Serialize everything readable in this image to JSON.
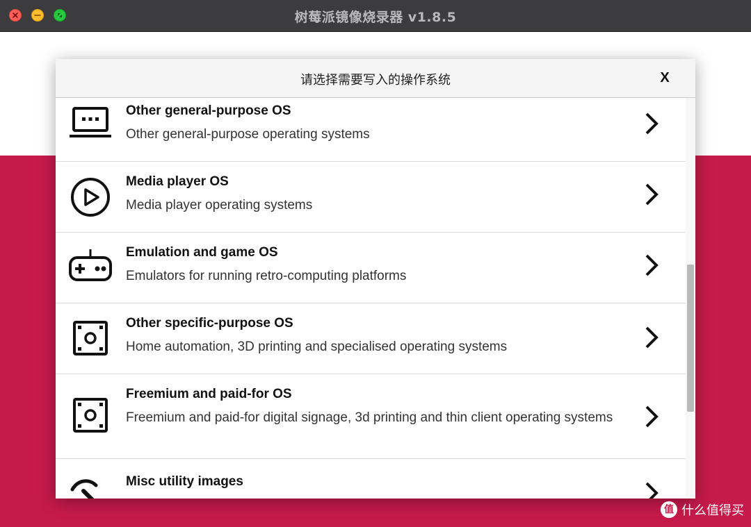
{
  "window": {
    "title": "树莓派镜像烧录器 v1.8.5"
  },
  "dialog": {
    "title": "请选择需要写入的操作系统",
    "close_label": "X"
  },
  "items": [
    {
      "title": "Other general-purpose OS",
      "desc": "Other general-purpose operating systems",
      "icon": "laptop-icon"
    },
    {
      "title": "Media player OS",
      "desc": "Media player operating systems",
      "icon": "play-circle-icon"
    },
    {
      "title": "Emulation and game OS",
      "desc": "Emulators for running retro-computing platforms",
      "icon": "gamepad-icon"
    },
    {
      "title": "Other specific-purpose OS",
      "desc": "Home automation, 3D printing and specialised operating systems",
      "icon": "box-icon"
    },
    {
      "title": "Freemium and paid-for OS",
      "desc": "Freemium and paid-for digital signage, 3d printing and thin client operating systems",
      "icon": "box-icon"
    },
    {
      "title": "Misc utility images",
      "desc": "",
      "icon": "tool-icon"
    }
  ],
  "watermark": {
    "logo": "值",
    "text": "什么值得买"
  },
  "colors": {
    "accent": "#c51a4a",
    "titlebar": "#3c3c3e"
  }
}
